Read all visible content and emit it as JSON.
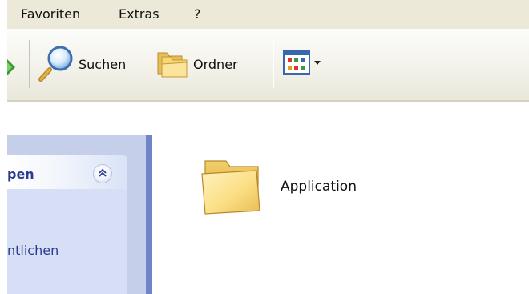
{
  "menu": {
    "favorites": "Favoriten",
    "extras": "Extras",
    "help": "?"
  },
  "toolbar": {
    "search_label": "Suchen",
    "folders_label": "Ordner"
  },
  "taskpane": {
    "header_title": "pen",
    "link_text": "ntlichen"
  },
  "content": {
    "items": [
      {
        "label": "Application",
        "type": "folder"
      }
    ]
  },
  "colors": {
    "toolbar_bg": "#f3f2ea",
    "menubar_bg": "#ece9d8",
    "taskpane_bg": "#c6cfe9",
    "taskpane_text": "#2b3b8f",
    "folder_yellow": "#f6d776"
  }
}
